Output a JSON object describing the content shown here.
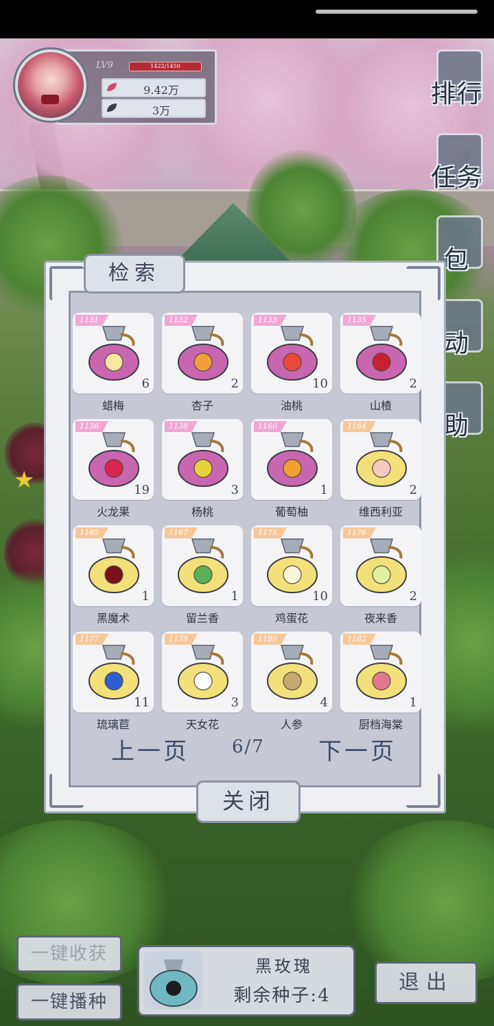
{
  "player": {
    "level": "LV9",
    "hp_text": "1422/1450",
    "stat1_value": "9.42万",
    "stat2_value": "3万"
  },
  "side_menu": [
    {
      "label": "排行",
      "icon": "leaderboard-icon"
    },
    {
      "label": "任务",
      "icon": "task-clipboard-icon"
    },
    {
      "label": "包",
      "icon": "gift-bag-icon"
    },
    {
      "label": "动",
      "icon": "activity-icon"
    },
    {
      "label": "助",
      "icon": "help-icon"
    }
  ],
  "dialog": {
    "title": "检索",
    "items": [
      {
        "id": "1131",
        "name": "蜡梅",
        "count": "6",
        "tag_color": "#f2a6d4",
        "bag_color": "#c866b0",
        "fruit_color": "#f7e7a0"
      },
      {
        "id": "1132",
        "name": "杏子",
        "count": "2",
        "tag_color": "#f2a6d4",
        "bag_color": "#c866b0",
        "fruit_color": "#f0a03a"
      },
      {
        "id": "1133",
        "name": "油桃",
        "count": "10",
        "tag_color": "#f2a6d4",
        "bag_color": "#c866b0",
        "fruit_color": "#e8493c"
      },
      {
        "id": "1135",
        "name": "山楂",
        "count": "2",
        "tag_color": "#f2a6d4",
        "bag_color": "#c866b0",
        "fruit_color": "#c7202e"
      },
      {
        "id": "1136",
        "name": "火龙果",
        "count": "19",
        "tag_color": "#f2a6d4",
        "bag_color": "#c866b0",
        "fruit_color": "#d9264f"
      },
      {
        "id": "1138",
        "name": "杨桃",
        "count": "3",
        "tag_color": "#f2a6d4",
        "bag_color": "#c866b0",
        "fruit_color": "#e8d23a"
      },
      {
        "id": "1160",
        "name": "葡萄柚",
        "count": "1",
        "tag_color": "#f2a6d4",
        "bag_color": "#c866b0",
        "fruit_color": "#f0a030"
      },
      {
        "id": "1164",
        "name": "维西利亚",
        "count": "2",
        "tag_color": "#f7c79a",
        "bag_color": "#f2e07a",
        "fruit_color": "#f4c9c0"
      },
      {
        "id": "1165",
        "name": "黑魔术",
        "count": "1",
        "tag_color": "#f7c79a",
        "bag_color": "#f2e07a",
        "fruit_color": "#7a1018"
      },
      {
        "id": "1167",
        "name": "留兰香",
        "count": "1",
        "tag_color": "#f7c79a",
        "bag_color": "#f2e07a",
        "fruit_color": "#5bb05a"
      },
      {
        "id": "1174",
        "name": "鸡蛋花",
        "count": "10",
        "tag_color": "#f7c79a",
        "bag_color": "#f2e07a",
        "fruit_color": "#fbf6d8"
      },
      {
        "id": "1176",
        "name": "夜来香",
        "count": "2",
        "tag_color": "#f7c79a",
        "bag_color": "#f2e07a",
        "fruit_color": "#dff0a0"
      },
      {
        "id": "1177",
        "name": "琉璃苣",
        "count": "11",
        "tag_color": "#f7c79a",
        "bag_color": "#f2e07a",
        "fruit_color": "#2d5fd0"
      },
      {
        "id": "1179",
        "name": "天女花",
        "count": "3",
        "tag_color": "#f7c79a",
        "bag_color": "#f2e07a",
        "fruit_color": "#ffffff"
      },
      {
        "id": "1180",
        "name": "人参",
        "count": "4",
        "tag_color": "#f7c79a",
        "bag_color": "#f2e07a",
        "fruit_color": "#c7a870"
      },
      {
        "id": "1182",
        "name": "厨档海棠",
        "count": "1",
        "tag_color": "#f7c79a",
        "bag_color": "#f2e07a",
        "fruit_color": "#e07890"
      }
    ],
    "prev_label": "上一页",
    "page_indicator": "6/7",
    "next_label": "下一页",
    "close_label": "关闭"
  },
  "bottom": {
    "harvest_all_label": "一键收获",
    "plant_all_label": "一键播种",
    "selected_seed_name": "黑玫瑰",
    "remaining_label": "剩余种子:4",
    "exit_label": "退出",
    "selected_seed_bag_color": "#6fb8c2"
  }
}
